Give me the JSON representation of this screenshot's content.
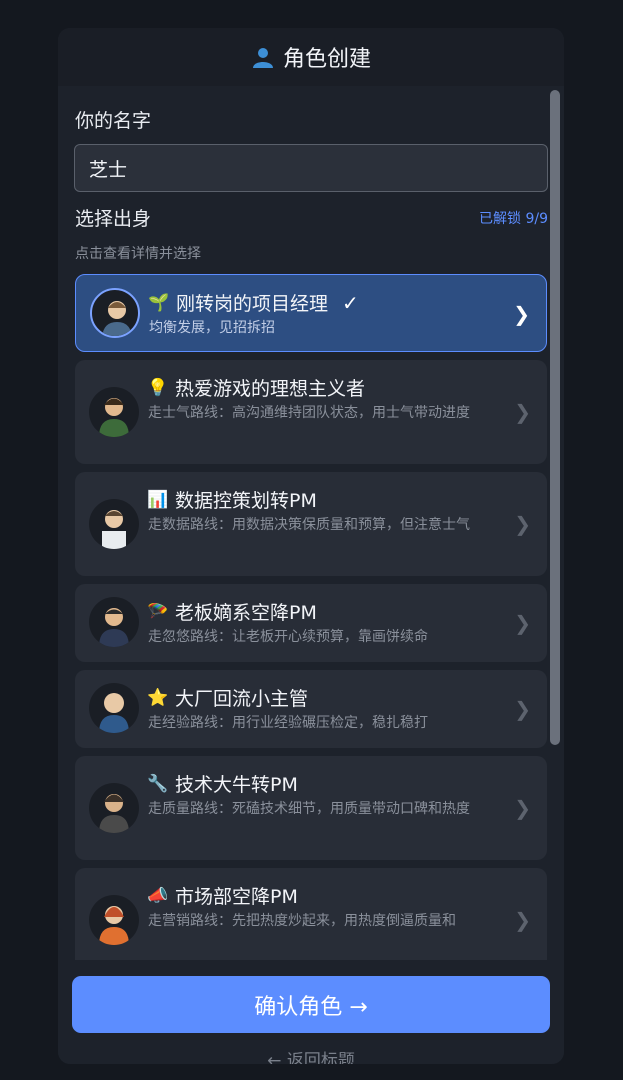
{
  "header": {
    "title": "角色创建",
    "icon": "person-icon"
  },
  "name_field": {
    "label": "你的名字",
    "value": "芝士"
  },
  "origin": {
    "label": "选择出身",
    "unlocked": "已解锁 9/9",
    "hint": "点击查看详情并选择"
  },
  "cards": [
    {
      "emoji": "🌱",
      "title": "刚转岗的项目经理",
      "desc": "均衡发展，见招拆招",
      "selected": true,
      "check": "✓"
    },
    {
      "emoji": "💡",
      "title": "热爱游戏的理想主义者",
      "desc": "走士气路线：高沟通维持团队状态，用士气带动进度"
    },
    {
      "emoji": "📊",
      "title": "数据控策划转PM",
      "desc": "走数据路线：用数据决策保质量和预算，但注意士气"
    },
    {
      "emoji": "🪂",
      "title": "老板嫡系空降PM",
      "desc": "走忽悠路线：让老板开心续预算，靠画饼续命"
    },
    {
      "emoji": "⭐",
      "title": "大厂回流小主管",
      "desc": "走经验路线：用行业经验碾压检定，稳扎稳打"
    },
    {
      "emoji": "🔧",
      "title": "技术大牛转PM",
      "desc": "走质量路线：死磕技术细节，用质量带动口碑和热度"
    },
    {
      "emoji": "📣",
      "title": "市场部空降PM",
      "desc": "走营销路线：先把热度炒起来，用热度倒逼质量和"
    }
  ],
  "footer": {
    "confirm_label": "确认角色 →",
    "back_label": "← 返回标题"
  },
  "colors": {
    "accent": "#5c8dff",
    "panel": "#1d222b",
    "card": "#282d37",
    "selected_card": "#2d4e82"
  }
}
